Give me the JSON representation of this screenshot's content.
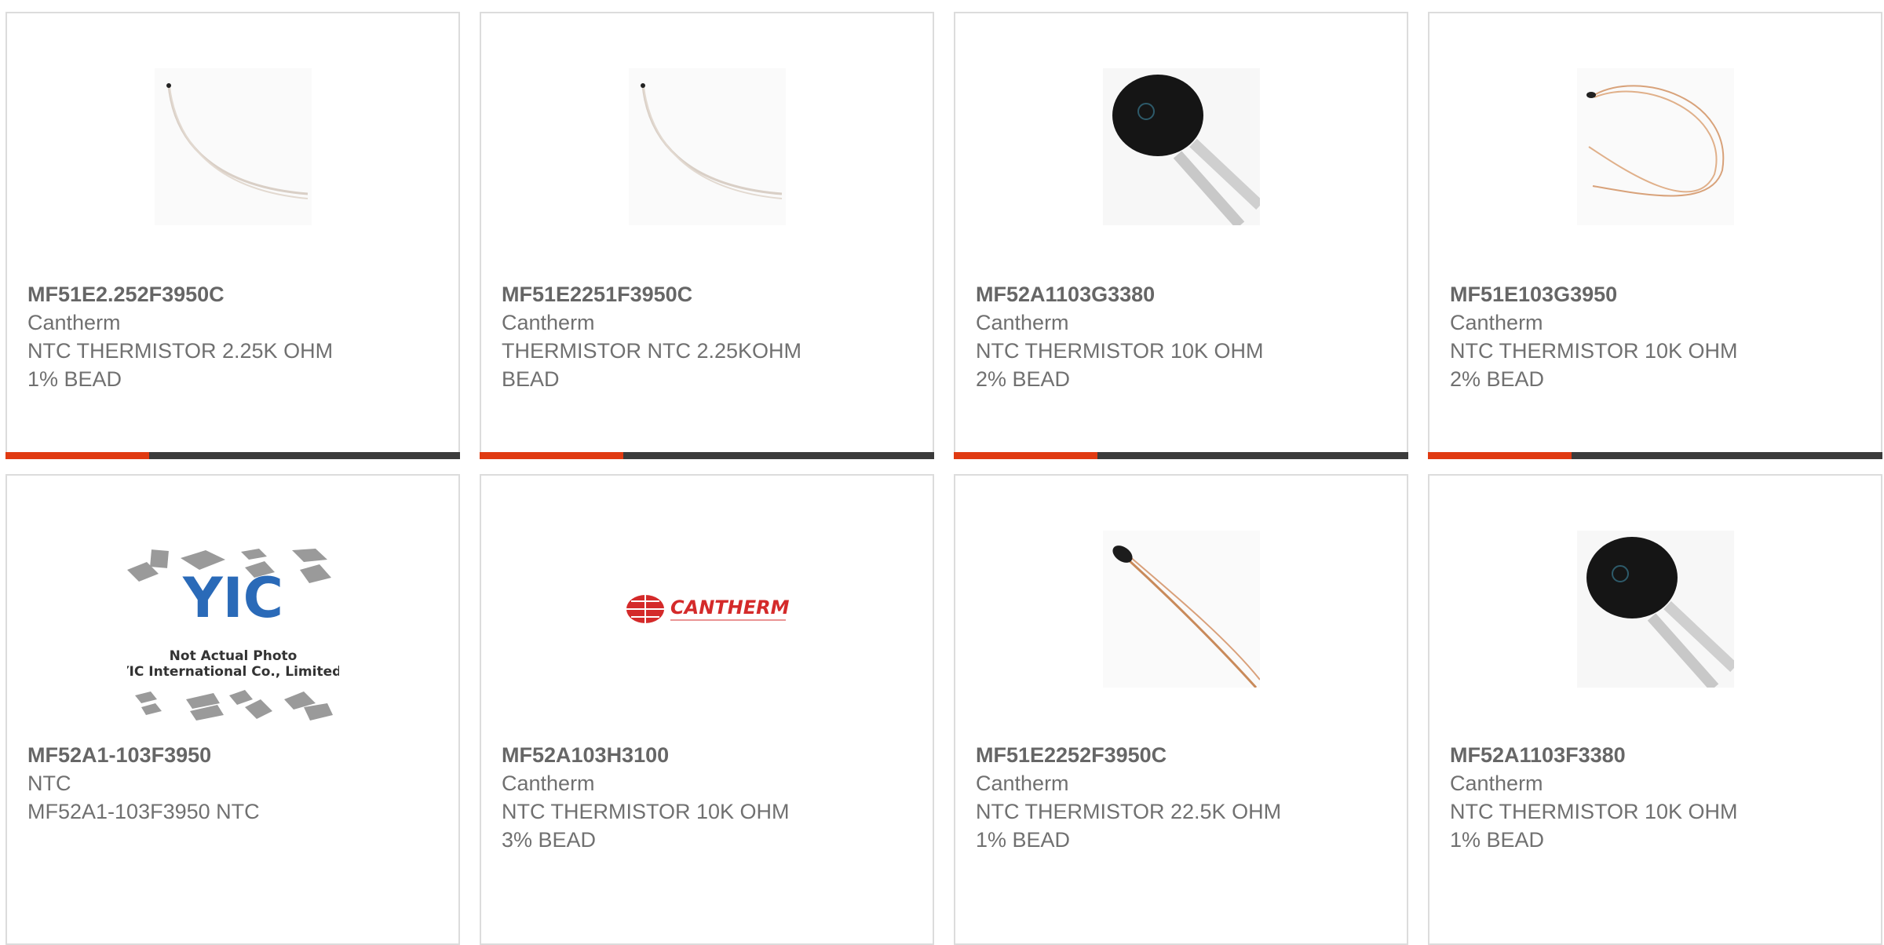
{
  "products": [
    {
      "part": "MF51E2.252F3950C",
      "maker": "Cantherm",
      "desc1": "NTC THERMISTOR 2.25K OHM",
      "desc2": "1% BEAD",
      "image": "wire-thermistor-photo"
    },
    {
      "part": "MF51E2251F3950C",
      "maker": "Cantherm",
      "desc1": "THERMISTOR NTC 2.25KOHM",
      "desc2": "BEAD",
      "image": "wire-thermistor-photo"
    },
    {
      "part": "MF52A1103G3380",
      "maker": "Cantherm",
      "desc1": "NTC THERMISTOR 10K OHM",
      "desc2": "2% BEAD",
      "image": "black-disc-thermistor-photo"
    },
    {
      "part": "MF51E103G3950",
      "maker": "Cantherm",
      "desc1": "NTC THERMISTOR 10K OHM",
      "desc2": "2% BEAD",
      "image": "copper-wire-thermistor-photo"
    },
    {
      "part": "MF52A1-103F3950",
      "maker": "NTC",
      "desc1": "MF52A1-103F3950 NTC",
      "desc2": "",
      "image": "placeholder-not-actual-photo",
      "placeholder_line1": "Not Actual Photo",
      "placeholder_line2": "YIC International Co., Limited."
    },
    {
      "part": "MF52A103H3100",
      "maker": "Cantherm",
      "desc1": "NTC THERMISTOR 10K OHM",
      "desc2": "3% BEAD",
      "image": "cantherm-logo",
      "logo_text": "CANTHERM"
    },
    {
      "part": "MF51E2252F3950C",
      "maker": "Cantherm",
      "desc1": "NTC THERMISTOR 22.5K OHM",
      "desc2": "1% BEAD",
      "image": "teardrop-thermistor-photo"
    },
    {
      "part": "MF52A1103F3380",
      "maker": "Cantherm",
      "desc1": "NTC THERMISTOR 10K OHM",
      "desc2": "1% BEAD",
      "image": "black-disc-thermistor-photo"
    }
  ],
  "colors": {
    "accent": "#e03a12",
    "bar": "#3b3b3b",
    "border": "#dcdcdc"
  }
}
